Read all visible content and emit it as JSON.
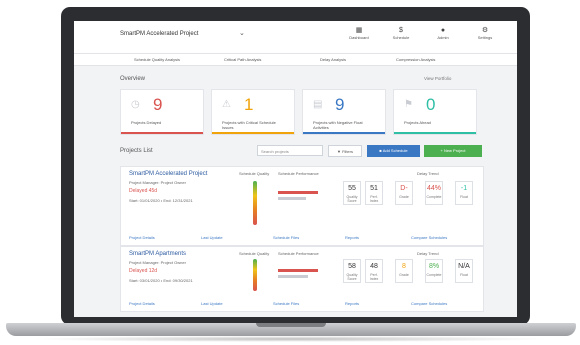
{
  "topbar": {
    "project_selector": "SmartPM Accelerated Project",
    "nav": [
      {
        "icon": "dashboard-icon",
        "glyph": "▦",
        "label": "Dashboard"
      },
      {
        "icon": "schedule-icon",
        "glyph": "$",
        "label": "Schedule"
      },
      {
        "icon": "user-icon",
        "glyph": "●",
        "label": "Admin"
      },
      {
        "icon": "settings-icon",
        "glyph": "⚙",
        "label": "Settings"
      }
    ]
  },
  "subnav": [
    {
      "label": "Schedule Quality Analysis"
    },
    {
      "label": "Critical Path Analysis"
    },
    {
      "label": "Delay Analysis"
    },
    {
      "label": "Compression Analysis"
    }
  ],
  "overview": {
    "title": "Overview",
    "link": "View Portfolio"
  },
  "stats": [
    {
      "value": "9",
      "label": "Projects Delayed",
      "color": "#d9534f",
      "icon": "clock-icon",
      "glyph": "◷"
    },
    {
      "value": "1",
      "label": "Projects with Critical Schedule Issues",
      "color": "#f0a30a",
      "icon": "warning-icon",
      "glyph": "⚠"
    },
    {
      "value": "9",
      "label": "Projects with Negative Float Activities",
      "color": "#3b78c4",
      "icon": "chart-icon",
      "glyph": "▤"
    },
    {
      "value": "0",
      "label": "Projects Ahead",
      "color": "#2ebfa5",
      "icon": "flag-icon",
      "glyph": "⚑"
    }
  ],
  "projects_toolbar": {
    "title": "Projects List",
    "search_placeholder": "Search projects",
    "filter_label": "Filters",
    "blue_button": "Add Schedule",
    "green_button": "New Project"
  },
  "projects": [
    {
      "name": "SmartPM Accelerated Project",
      "meta1": "Project Manager: Project Owner",
      "meta2": "Start: 01/01/2020 • End: 12/31/2021",
      "delay": "Delayed 45d",
      "col_heads": [
        "Schedule Quality",
        "Schedule Performance",
        "Delay Trend"
      ],
      "boxes": [
        {
          "value": "55",
          "label": "Quality Score",
          "color": "#333333"
        },
        {
          "value": "51",
          "label": "Perf. Index",
          "color": "#333333"
        },
        {
          "value": "D-",
          "label": "Grade",
          "color": "#d9534f"
        },
        {
          "value": "44%",
          "label": "Complete",
          "color": "#d9534f"
        },
        {
          "value": "-1",
          "label": "Float",
          "color": "#2ebfa5"
        }
      ],
      "footer": [
        "Project Details",
        "Last Update",
        "Schedule Files",
        "Reports",
        "Compare Schedules"
      ]
    },
    {
      "name": "SmartPM Apartments",
      "meta1": "Project Manager: Project Owner",
      "meta2": "Start: 03/01/2020 • End: 09/30/2021",
      "delay": "Delayed 12d",
      "col_heads": [
        "Schedule Quality",
        "Schedule Performance",
        "Delay Trend"
      ],
      "boxes": [
        {
          "value": "58",
          "label": "Quality Score",
          "color": "#333333"
        },
        {
          "value": "48",
          "label": "Perf. Index",
          "color": "#333333"
        },
        {
          "value": "8",
          "label": "Grade",
          "color": "#f0a30a"
        },
        {
          "value": "8%",
          "label": "Complete",
          "color": "#4caf50"
        },
        {
          "value": "N/A",
          "label": "Float",
          "color": "#333333"
        }
      ],
      "footer": [
        "Project Details",
        "Last Update",
        "Schedule Files",
        "Reports",
        "Compare Schedules"
      ]
    }
  ]
}
